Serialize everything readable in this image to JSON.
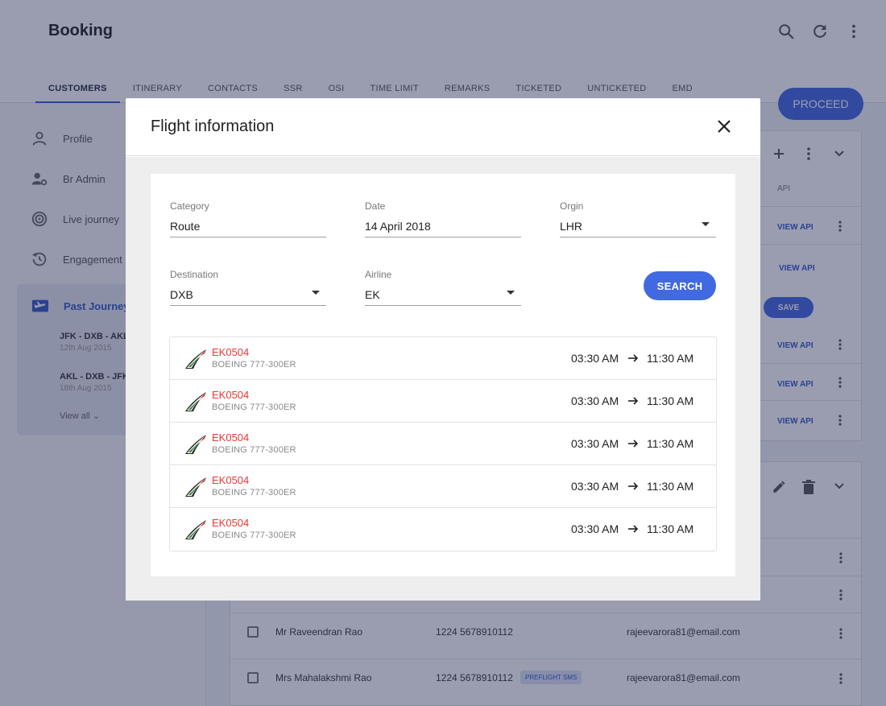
{
  "app": {
    "title": "Booking",
    "tabs": [
      "CUSTOMERS",
      "ITINERARY",
      "CONTACTS",
      "SSR",
      "OSI",
      "TIME LIMIT",
      "REMARKS",
      "TICKETED",
      "UNTICKETED",
      "EMD"
    ],
    "active_tab": "CUSTOMERS",
    "proceed_label": "PROCEED"
  },
  "sidebar": {
    "items": [
      {
        "label": "Profile",
        "icon": "person-icon"
      },
      {
        "label": "Br Admin",
        "icon": "admin-icon"
      },
      {
        "label": "Live journey",
        "icon": "radar-icon"
      },
      {
        "label": "Engagement History",
        "icon": "history-icon"
      }
    ],
    "past": {
      "label": "Past Journeys",
      "icon": "flight-takeoff-icon",
      "journeys": [
        {
          "route": "JFK - DXB - AKL",
          "date": "12th Aug 2015"
        },
        {
          "route": "AKL - DXB - JFK",
          "date": "18th Aug 2015"
        }
      ],
      "view_all": "View all"
    }
  },
  "panel": {
    "api_header": "API",
    "view_api": "VIEW API",
    "save": "SAVE",
    "passengers": [
      {
        "name": "Mr Raveendran Rao",
        "phone": "1224 5678910112",
        "email": "rajeevarora81@email.com",
        "badge": ""
      },
      {
        "name": "Mrs Mahalakshmi Rao",
        "phone": "1224 5678910112",
        "email": "rajeevarora81@email.com",
        "badge": "PREFLIGHT SMS"
      }
    ]
  },
  "modal": {
    "title": "Flight information",
    "fields": {
      "category": {
        "label": "Category",
        "value": "Route"
      },
      "date": {
        "label": "Date",
        "value": "14 April 2018"
      },
      "origin": {
        "label": "Orgin",
        "value": "LHR"
      },
      "destination": {
        "label": "Destination",
        "value": "DXB"
      },
      "airline": {
        "label": "Airline",
        "value": "EK"
      }
    },
    "search_label": "SEARCH",
    "flights": [
      {
        "code": "EK0504",
        "aircraft": "BOEING 777-300ER",
        "depart": "03:30 AM",
        "arrive": "11:30 AM"
      },
      {
        "code": "EK0504",
        "aircraft": "BOEING 777-300ER",
        "depart": "03:30 AM",
        "arrive": "11:30 AM"
      },
      {
        "code": "EK0504",
        "aircraft": "BOEING 777-300ER",
        "depart": "03:30 AM",
        "arrive": "11:30 AM"
      },
      {
        "code": "EK0504",
        "aircraft": "BOEING 777-300ER",
        "depart": "03:30 AM",
        "arrive": "11:30 AM"
      },
      {
        "code": "EK0504",
        "aircraft": "BOEING 777-300ER",
        "depart": "03:30 AM",
        "arrive": "11:30 AM"
      }
    ]
  },
  "colors": {
    "accent": "#4169e1",
    "flight_code": "#e53935",
    "scrim": "#1e2650"
  }
}
